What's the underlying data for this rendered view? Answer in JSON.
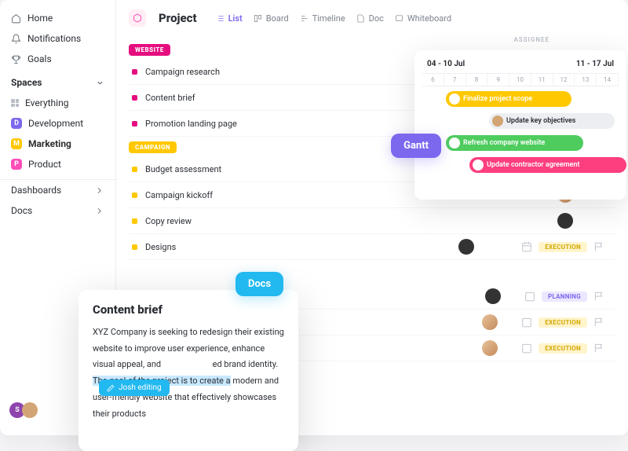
{
  "sidebar": {
    "nav": [
      {
        "label": "Home"
      },
      {
        "label": "Notifications"
      },
      {
        "label": "Goals"
      }
    ],
    "spaces_header": "Spaces",
    "everything": "Everything",
    "spaces": [
      {
        "letter": "D",
        "label": "Development",
        "color": "#7b68ee"
      },
      {
        "letter": "M",
        "label": "Marketing",
        "color": "#ffc800",
        "active": true
      },
      {
        "letter": "P",
        "label": "Product",
        "color": "#ff4db8"
      }
    ],
    "bottom": [
      {
        "label": "Dashboards"
      },
      {
        "label": "Docs"
      }
    ],
    "user_initial": "S"
  },
  "header": {
    "title": "Project",
    "views": [
      {
        "label": "List",
        "active": true
      },
      {
        "label": "Board"
      },
      {
        "label": "Timeline"
      },
      {
        "label": "Doc"
      },
      {
        "label": "Whiteboard"
      }
    ]
  },
  "columns": {
    "assignee": "ASSIGNEE"
  },
  "groups": {
    "website": {
      "label": "WEBSITE",
      "tasks": [
        {
          "name": "Campaign research"
        },
        {
          "name": "Content brief"
        },
        {
          "name": "Promotion landing page"
        }
      ]
    },
    "campaign": {
      "label": "CAMPAIGN",
      "tasks": [
        {
          "name": "Budget assessment"
        },
        {
          "name": "Campaign kickoff"
        },
        {
          "name": "Copy review"
        },
        {
          "name": "Designs"
        }
      ]
    }
  },
  "extra_rows": [
    {
      "status": "EXECUTION",
      "cls": "exec"
    },
    {
      "status": "PLANNING",
      "cls": "plan"
    },
    {
      "status": "EXECUTION",
      "cls": "exec"
    },
    {
      "status": "EXECUTION",
      "cls": "exec"
    }
  ],
  "gantt": {
    "label": "Gantt",
    "week1": "04 - 10 Jul",
    "week2": "11 - 17 Jul",
    "days": [
      "6",
      "7",
      "8",
      "9",
      "10",
      "11",
      "12",
      "13",
      "14"
    ],
    "bars": {
      "scope": "Finalize project scope",
      "obj": "Update key objectives",
      "refresh": "Refresh company website",
      "contract": "Update contractor agreement"
    }
  },
  "docs": {
    "label": "Docs",
    "title": "Content brief",
    "body_pre": "XYZ Company is seeking to redesign their existing website to improve user experience, enhance visual appeal, and ",
    "body_gap": "ed brand identity. ",
    "body_hl": "The goal of the project is to create a",
    "body_post": " modern and user-friendly website that effectively showcases their products",
    "editing": "Josh editing"
  }
}
